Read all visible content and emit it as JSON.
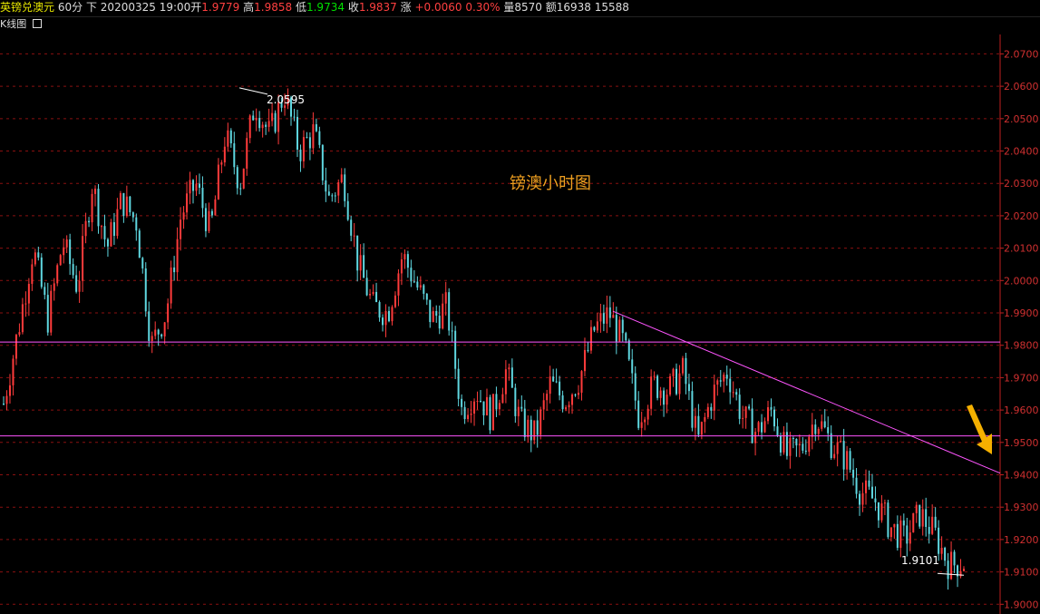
{
  "header": {
    "symbol": "英镑兑澳元",
    "period": "60分",
    "direction": "下",
    "datetime": "20200325 19:00",
    "open_label": "开",
    "open": "1.9779",
    "high_label": "高",
    "high": "1.9858",
    "low_label": "低",
    "low": "1.9734",
    "close_label": "收",
    "close": "1.9837",
    "change_label": "涨",
    "change": "+0.0060",
    "change_pct": "0.30%",
    "volume_label": "量",
    "volume": "8570",
    "amount_label": "额",
    "amount": "16938",
    "extra": "15588"
  },
  "subbar": {
    "label": "K线图",
    "icon": "window-icon"
  },
  "chart_data": {
    "type": "candlestick",
    "title": "镑澳小时图",
    "ylim": [
      1.897,
      2.076
    ],
    "y_ticks": [
      "2.0700",
      "2.0600",
      "2.0500",
      "2.0400",
      "2.0300",
      "2.0200",
      "2.0100",
      "2.0000",
      "1.9900",
      "1.9800",
      "1.9700",
      "1.9600",
      "1.9500",
      "1.9400",
      "1.9300",
      "1.9200",
      "1.9100",
      "1.9000"
    ],
    "colors": {
      "up": "#ff3b3b",
      "down": "#5fd7e0",
      "grid": "#8a1010",
      "axis": "#c02020",
      "line": "#ff55ff",
      "title": "#f0a020",
      "arrow": "#f5b000"
    },
    "price_path": [
      1.962,
      1.985,
      2.01,
      1.988,
      2.012,
      1.998,
      2.03,
      2.01,
      2.025,
      2.018,
      1.98,
      1.99,
      2.02,
      2.03,
      2.015,
      2.045,
      2.03,
      2.055,
      2.045,
      2.058,
      2.04,
      2.046,
      2.025,
      2.032,
      2.005,
      1.992,
      1.99,
      2.008,
      1.998,
      1.988,
      1.992,
      1.96,
      1.966,
      1.958,
      1.972,
      1.956,
      1.952,
      1.968,
      1.963,
      1.97,
      1.985,
      1.99,
      1.98,
      1.958,
      1.968,
      1.966,
      1.972,
      1.95,
      1.965,
      1.972,
      1.958,
      1.953,
      1.96,
      1.946,
      1.948,
      1.958,
      1.95,
      1.945,
      1.935,
      1.932,
      1.924,
      1.92,
      1.928,
      1.922,
      1.912,
      1.913
    ],
    "horizontal_lines": [
      1.981,
      1.952
    ],
    "trendline": {
      "from_price": 1.9905,
      "to_price": 1.9405
    },
    "annotations": [
      {
        "label": "2.0595",
        "price": 2.0595
      },
      {
        "label": "1.9101",
        "price": 1.9101
      }
    ]
  }
}
